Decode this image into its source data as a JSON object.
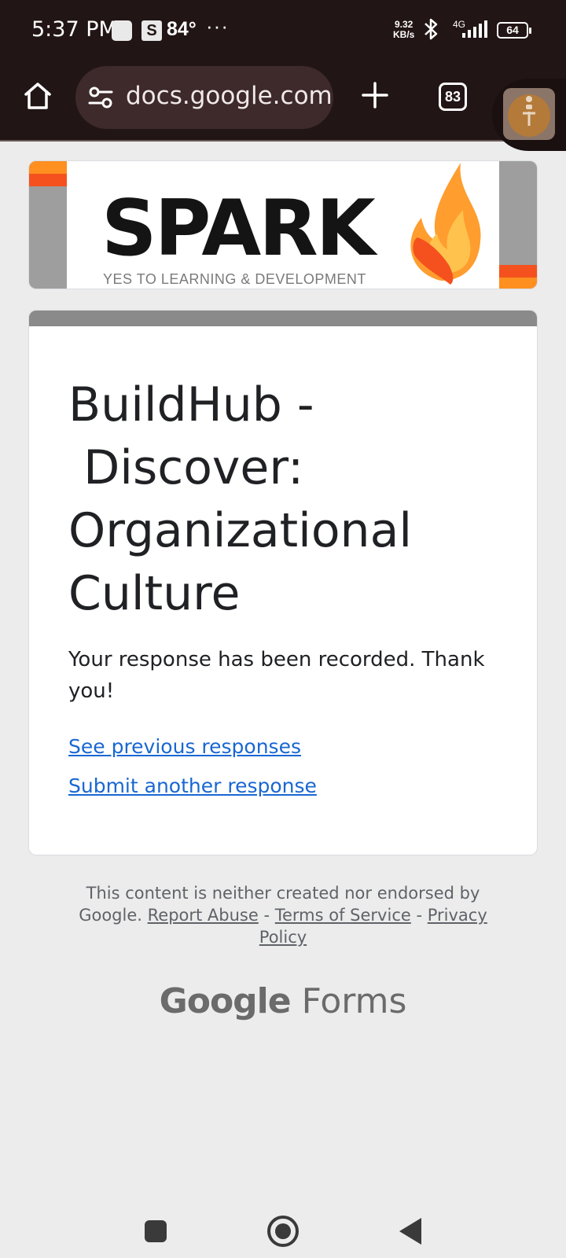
{
  "status_bar": {
    "time": "5:37 PM",
    "s_badge": "S",
    "temperature": "84°",
    "more": "···",
    "net_speed_value": "9.32",
    "net_speed_unit": "KB/s",
    "network": "4G",
    "battery": "64"
  },
  "browser": {
    "url": "docs.google.com",
    "tab_count": "83"
  },
  "banner": {
    "brand": "SPARK",
    "tagline": "YES TO LEARNING & DEVELOPMENT",
    "colors": {
      "orange": "#ff8f1f",
      "red_orange": "#f4511e",
      "gray": "#9e9e9e"
    }
  },
  "form": {
    "title": "BuildHub -\n Discover:\nOrganizational\nCulture",
    "confirmation": "Your response has been recorded. Thank you!",
    "link_previous": "See previous responses",
    "link_submit_another": "Submit another response"
  },
  "footer": {
    "disclaimer": "This content is neither created nor endorsed by Google.",
    "report_abuse": "Report Abuse",
    "sep": "-",
    "terms": "Terms of Service",
    "privacy": "Privacy Policy",
    "logo_google": "Google",
    "logo_forms": "Forms"
  }
}
